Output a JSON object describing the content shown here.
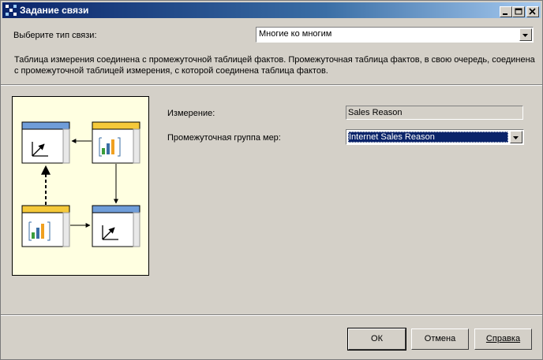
{
  "window": {
    "title": "Задание связи"
  },
  "relation_type": {
    "label": "Выберите тип связи:",
    "value": "Многие ко многим"
  },
  "description": "Таблица измерения соединена с промежуточной таблицей фактов. Промежуточная таблица фактов, в свою очередь, соединена с промежуточной таблицей измерения, с которой соединена таблица фактов.",
  "dimension": {
    "label": "Измерение:",
    "value": "Sales Reason"
  },
  "measure_group": {
    "label": "Промежуточная группа мер:",
    "value": "Internet Sales Reason"
  },
  "buttons": {
    "ok": "ОК",
    "cancel": "Отмена",
    "help": "Справка"
  },
  "colors": {
    "dimension_header": "#6f9dd9",
    "fact_header": "#f5c93a",
    "diagram_bg": "#ffffe1"
  }
}
